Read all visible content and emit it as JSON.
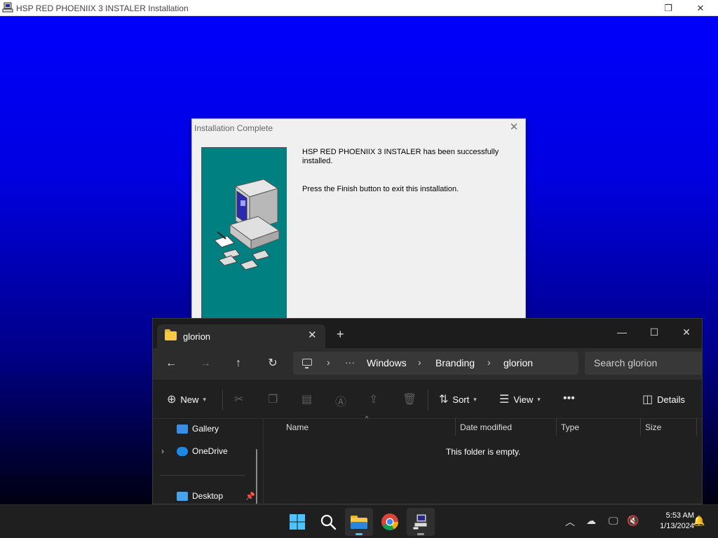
{
  "installer": {
    "window_title": "HSP RED PHOENIIX 3 INSTALER Installation",
    "background_colors": [
      "#0000ff",
      "#000088",
      "#000010"
    ]
  },
  "dialog": {
    "title": "Installation Complete",
    "message_success": "HSP RED PHOENIIX 3 INSTALER has been successfully installed.",
    "message_finish": "Press the Finish button to exit this installation.",
    "panel_color": "#008080"
  },
  "explorer": {
    "tab_label": "glorion",
    "breadcrumb": [
      "Windows",
      "Branding",
      "glorion"
    ],
    "search_placeholder": "Search glorion",
    "commands": {
      "new": "New",
      "sort": "Sort",
      "view": "View",
      "details": "Details"
    },
    "nav_items": [
      "Gallery",
      "OneDrive",
      "Desktop"
    ],
    "columns": [
      "Name",
      "Date modified",
      "Type",
      "Size"
    ],
    "empty_message": "This folder is empty."
  },
  "taskbar": {
    "apps": [
      "start-icon",
      "search-icon",
      "file-explorer-icon",
      "chrome-icon",
      "installer-icon"
    ],
    "time": "5:53 AM",
    "date": "1/13/2024"
  }
}
